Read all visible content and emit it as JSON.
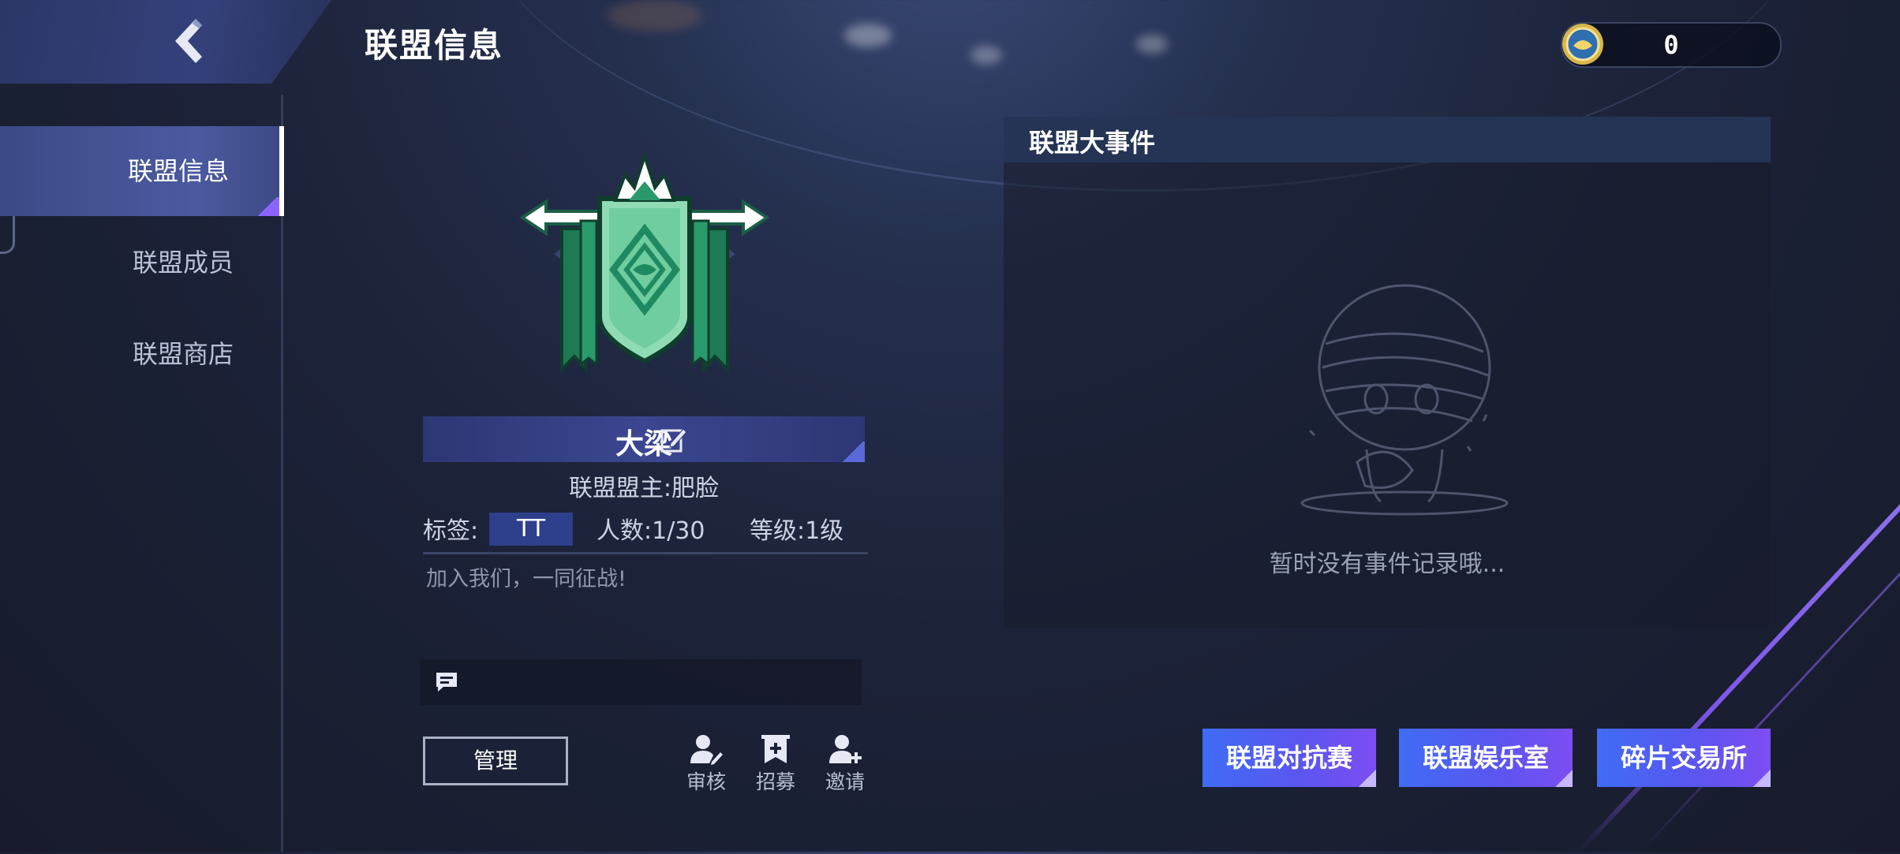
{
  "header": {
    "title": "联盟信息",
    "currency_value": "0"
  },
  "sidebar": {
    "items": [
      {
        "label": "联盟信息",
        "active": true
      },
      {
        "label": "联盟成员",
        "active": false
      },
      {
        "label": "联盟商店",
        "active": false
      }
    ]
  },
  "alliance": {
    "name": "大梁",
    "leader": "联盟盟主:肥脸",
    "tag_label": "标签:",
    "tag_value": "TT",
    "members": "人数:1/30",
    "level": "等级:1级",
    "slogan": "加入我们，一同征战!"
  },
  "actions": {
    "manage": "管理",
    "review": "审核",
    "recruit": "招募",
    "invite": "邀请"
  },
  "events": {
    "title": "联盟大事件",
    "empty_text": "暂时没有事件记录哦..."
  },
  "buttons": {
    "rivalry": "联盟对抗赛",
    "entertainment": "联盟娱乐室",
    "fragment_exchange": "碎片交易所"
  },
  "colors": {
    "accent_blue": "#3f6cf5",
    "accent_purple": "#7c4df2",
    "emblem_green": "#1f8a62"
  }
}
